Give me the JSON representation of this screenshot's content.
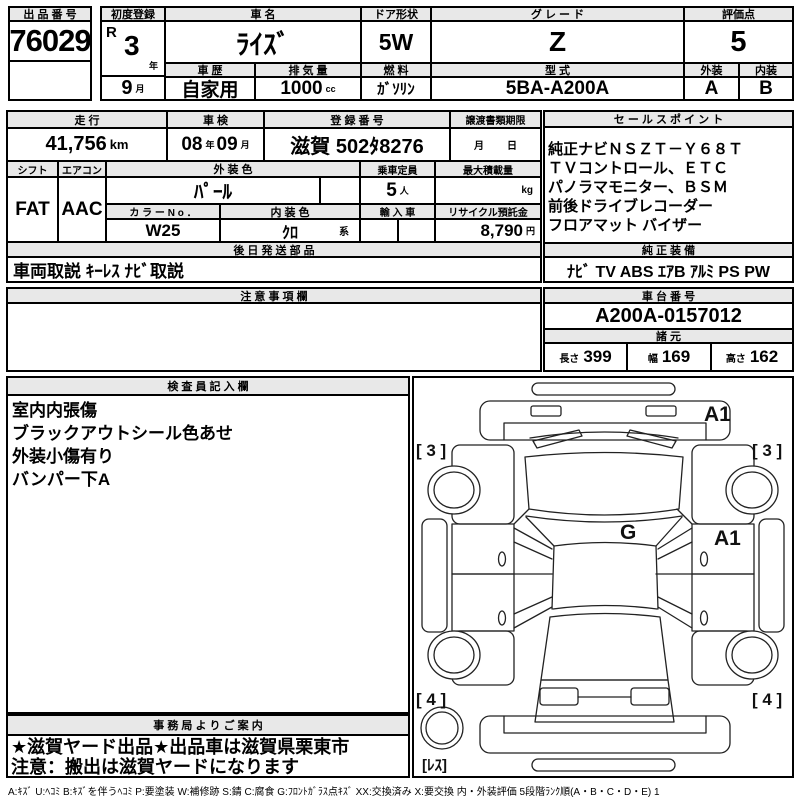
{
  "top": {
    "lot_label": "出 品 番 号",
    "lot_number": "76029",
    "first_reg_label": "初度登録",
    "first_reg_era": "R",
    "first_reg_year": "3",
    "first_reg_year_unit": "年",
    "first_reg_month": "9",
    "first_reg_month_unit": "月",
    "car_name_label": "車 名",
    "car_name": "ﾗｲｽﾞ",
    "history_label": "車 歴",
    "history": "自家用",
    "displacement_label": "排 気 量",
    "displacement": "1000",
    "displacement_unit": "cc",
    "door_label": "ドア形状",
    "door": "5W",
    "fuel_label": "燃 料",
    "fuel": "ｶﾞｿﾘﾝ",
    "grade_label": "グ レ ー ド",
    "grade": "Z",
    "model_label": "型 式",
    "model": "5BA-A200A",
    "score_label": "評価点",
    "score": "5",
    "exterior_label": "外装",
    "exterior": "A",
    "interior_label": "内装",
    "interior": "B"
  },
  "middle": {
    "mileage_label": "走 行",
    "mileage": "41,756",
    "mileage_unit": "km",
    "inspection_label": "車 検",
    "inspection_year": "08",
    "inspection_year_unit": "年",
    "inspection_month": "09",
    "inspection_month_unit": "月",
    "reg_no_label": "登 録 番 号",
    "reg_no": "滋賀 502ﾀ8276",
    "transfer_label": "譲渡書類期限",
    "transfer_month_label": "月",
    "transfer_day_label": "日",
    "shift_label": "シフト",
    "shift": "FAT",
    "ac_label": "エアコン",
    "ac": "AAC",
    "ext_color_label": "外 装 色",
    "ext_color": "ﾊﾟｰﾙ",
    "capacity_label": "乗車定員",
    "capacity": "5",
    "capacity_unit": "人",
    "max_load_label": "最大積載量",
    "max_load_unit": "kg",
    "color_no_label": "カ ラ ー N o ．",
    "color_no": "W25",
    "int_color_label": "内 装 色",
    "int_color": "ｸﾛ",
    "int_color_suffix": "系",
    "import_label": "輸 入 車",
    "recycle_label": "リサイクル預託金",
    "recycle_fee": "8,790",
    "recycle_unit": "円",
    "later_parts_label": "後 日 発 送 部 品",
    "later_parts": "車両取説 ｷｰﾚｽ ﾅﾋﾞ取説",
    "notes_label": "注 意 事 項 欄"
  },
  "sales": {
    "label": "セ ー ル ス ポ イ ン ト",
    "lines": [
      "純正ナビＮＳＺＴ－Ｙ６８Ｔ",
      "ＴＶコントロール、ＥＴＣ",
      "パノラマモニター、ＢＳＭ",
      "前後ドライブレコーダー",
      "フロアマット バイザー"
    ],
    "equip_label": "純 正 装 備",
    "equipment": "ﾅﾋﾞ TV ABS ｴｱB ｱﾙﾐ PS PW"
  },
  "chassis": {
    "label": "車 台 番 号",
    "number": "A200A-0157012",
    "spec_label": "諸 元",
    "length_label": "長さ",
    "length": "399",
    "width_label": "幅",
    "width": "169",
    "height_label": "高さ",
    "height": "162"
  },
  "inspector": {
    "label": "検 査 員 記 入 欄",
    "lines": [
      "室内内張傷",
      "ブラックアウトシール色あせ",
      "外装小傷有り",
      "バンパー下A"
    ]
  },
  "office": {
    "label": "事 務 局 よ り ご 案 内",
    "lines": [
      "★滋賀ヤード出品★出品車は滋賀県栗東市",
      "注意：搬出は滋賀ヤードになります"
    ]
  },
  "diagram": {
    "marks": {
      "front_bumper": "A1",
      "tire_front_left": "[ 3 ]",
      "tire_front_right": "[ 3 ]",
      "windshield": "G",
      "door_front_right": "A1",
      "tire_rear_left": "[ 4 ]",
      "tire_rear_right": "[ 4 ]",
      "spare": "[ﾚｽ]"
    }
  },
  "legend": "A:ｷｽﾞ U:ﾍｺﾐ B:ｷｽﾞを伴うﾍｺﾐ P:要塗装 W:補修跡 S:錆 C:腐食 G:ﾌﾛﾝﾄｶﾞﾗｽ点ｷｽﾞ XX:交換済み X:要交換  内・外装評価 5段階ﾗﾝｸ順(A・B・C・D・E) 1",
  "colors": {
    "header_bg": "#e8e8e8",
    "border": "#000000",
    "background": "#ffffff"
  }
}
